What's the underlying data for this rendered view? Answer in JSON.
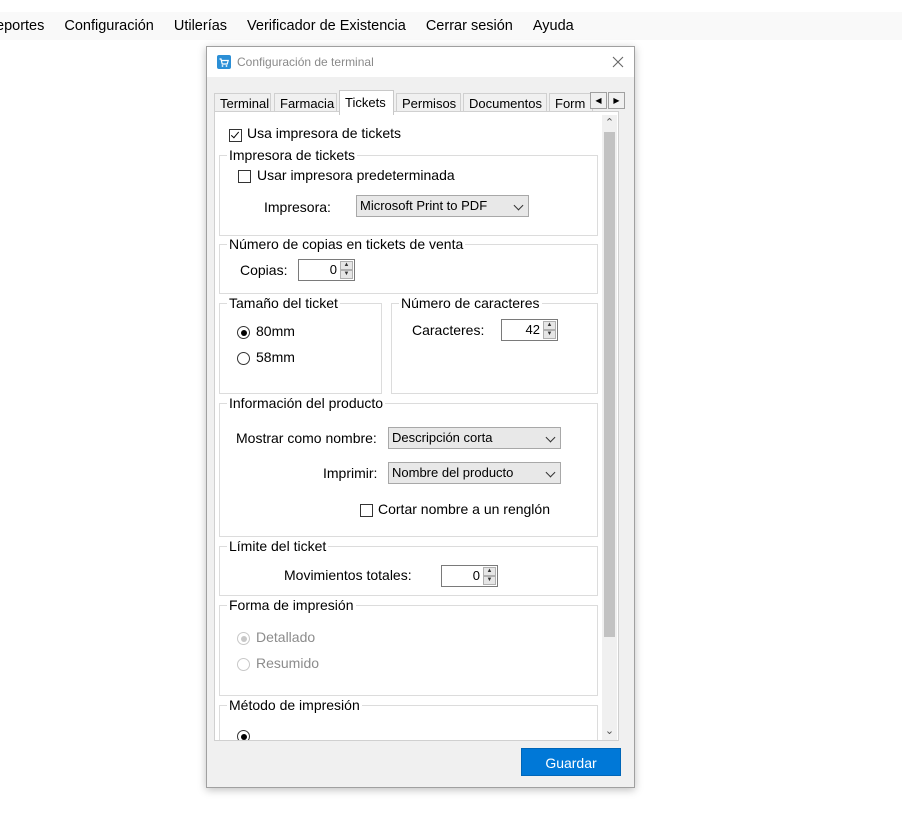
{
  "menubar": {
    "items": [
      "eportes",
      "Configuración",
      "Utilerías",
      "Verificador de Existencia",
      "Cerrar sesión",
      "Ayuda"
    ]
  },
  "dialog": {
    "title": "Configuración de terminal",
    "close_icon": "close-icon",
    "app_icon": "cart-icon",
    "tabs": [
      "Terminal",
      "Farmacia",
      "Tickets",
      "Permisos",
      "Documentos",
      "Form"
    ],
    "active_tab": "Tickets",
    "save_label": "Guardar"
  },
  "tickets": {
    "use_printer_label": "Usa impresora de tickets",
    "use_printer_checked": true,
    "printer_group": {
      "legend": "Impresora de tickets",
      "use_default_label": "Usar impresora predeterminada",
      "use_default_checked": false,
      "printer_label": "Impresora:",
      "printer_value": "Microsoft Print to PDF"
    },
    "copies_group": {
      "legend": "Número de copias en tickets de venta",
      "copies_label": "Copias:",
      "copies_value": "0"
    },
    "size_group": {
      "legend": "Tamaño del ticket",
      "opt_80": "80mm",
      "opt_58": "58mm",
      "selected": "80mm"
    },
    "chars_group": {
      "legend": "Número de caracteres",
      "chars_label": "Caracteres:",
      "chars_value": "42"
    },
    "product_group": {
      "legend": "Información del producto",
      "show_name_label": "Mostrar como nombre:",
      "show_name_value": "Descripción corta",
      "print_label": "Imprimir:",
      "print_value": "Nombre del producto",
      "cut_name_label": "Cortar nombre a un renglón",
      "cut_name_checked": false
    },
    "limit_group": {
      "legend": "Límite del ticket",
      "movements_label": "Movimientos totales:",
      "movements_value": "0"
    },
    "print_form_group": {
      "legend": "Forma de impresión",
      "opt_detailed": "Detallado",
      "opt_summary": "Resumido",
      "selected": "Detallado"
    },
    "print_method_group": {
      "legend": "Método de impresión"
    }
  }
}
